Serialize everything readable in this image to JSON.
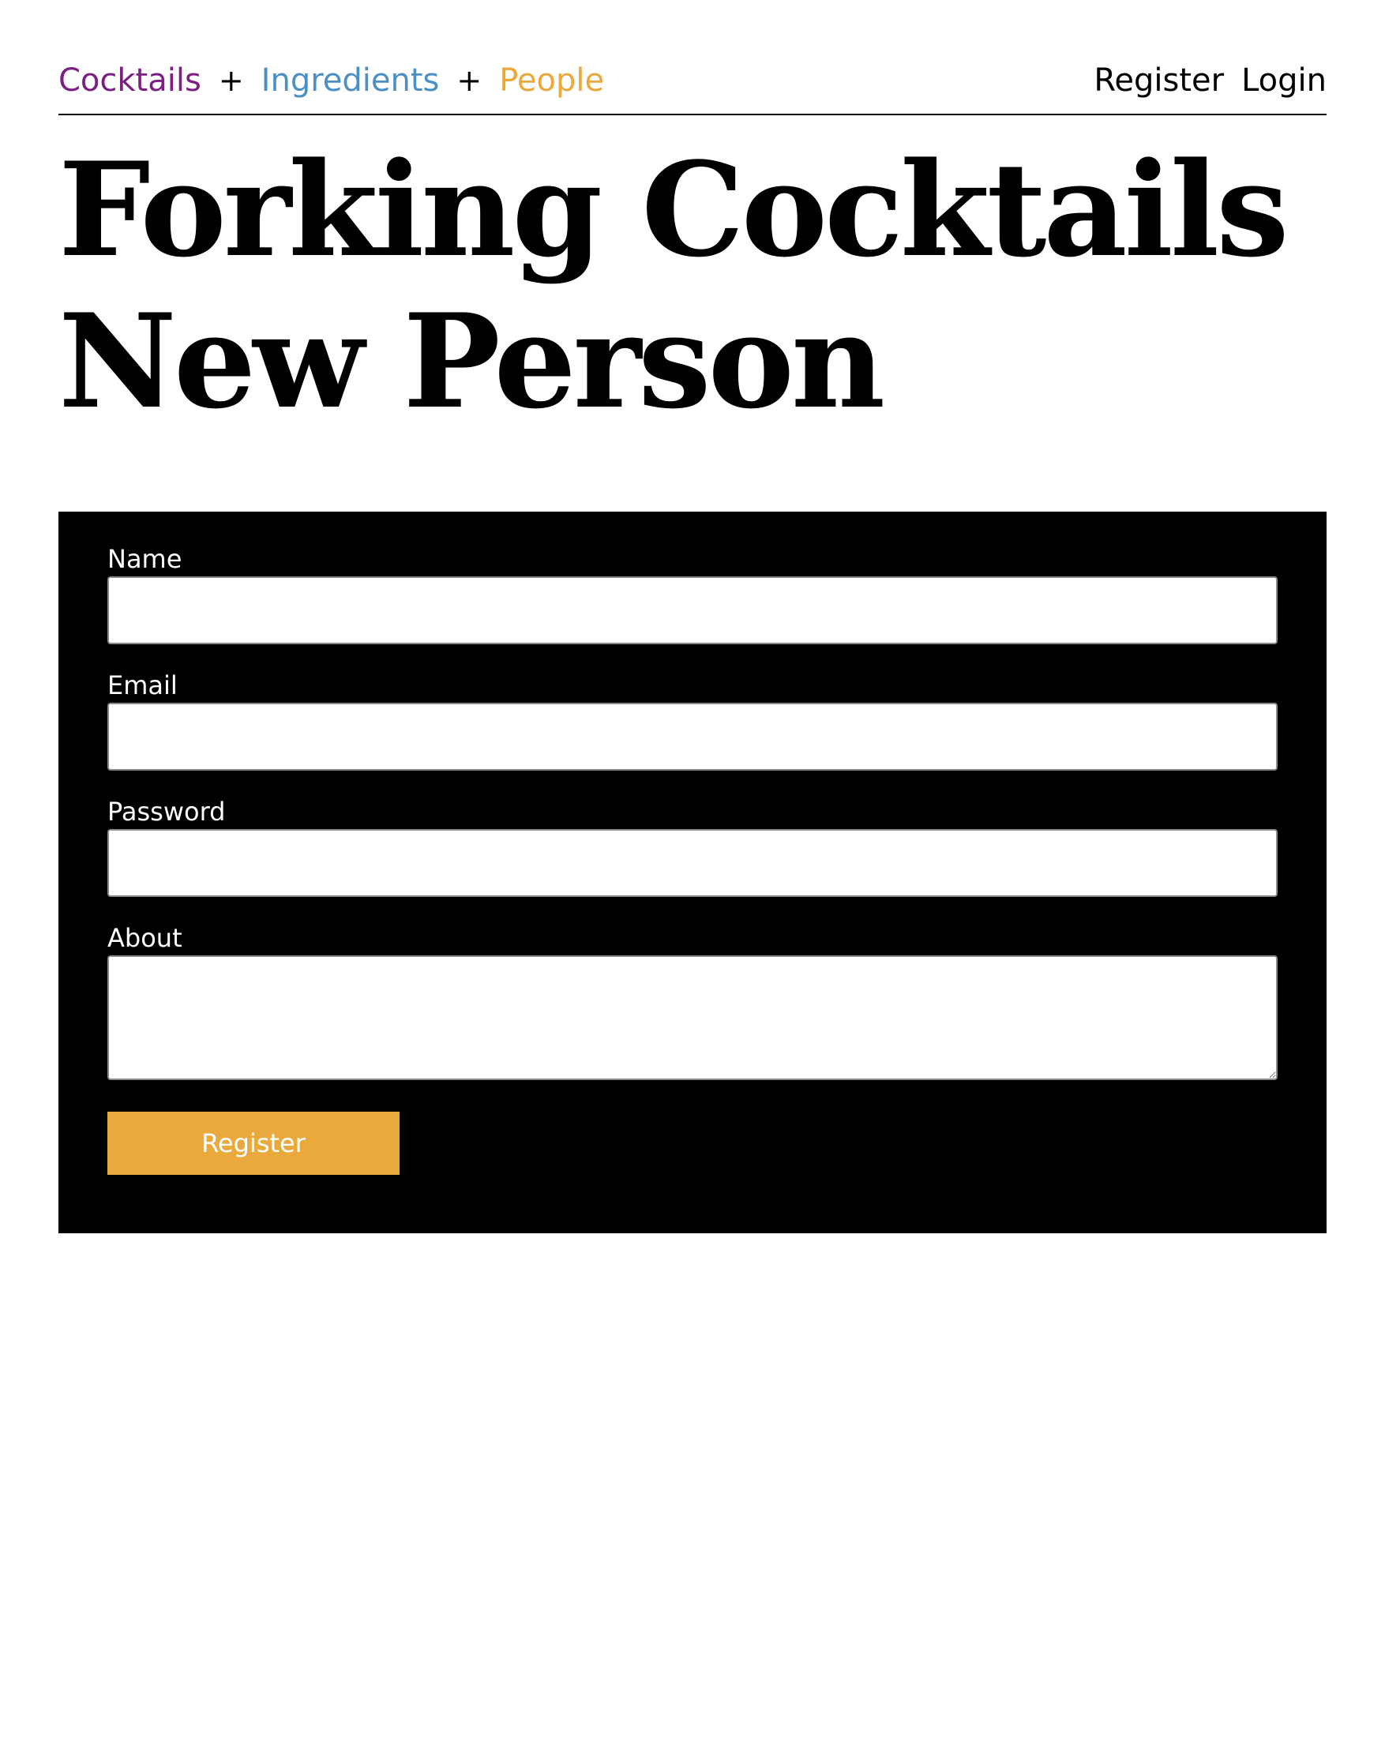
{
  "nav": {
    "links": [
      {
        "label": "Cocktails",
        "color": "#7b1f82"
      },
      {
        "label": "Ingredients",
        "color": "#4a90c4"
      },
      {
        "label": "People",
        "color": "#eaa93d"
      }
    ],
    "separator": "+",
    "register_label": "Register",
    "login_label": "Login"
  },
  "header": {
    "site_title": "Forking Cocktails",
    "page_title": "New Person"
  },
  "form": {
    "name_label": "Name",
    "name_value": "",
    "email_label": "Email",
    "email_value": "",
    "password_label": "Password",
    "password_value": "",
    "about_label": "About",
    "about_value": "",
    "submit_label": "Register",
    "submit_color": "#eaa93d",
    "panel_color": "#000000"
  }
}
